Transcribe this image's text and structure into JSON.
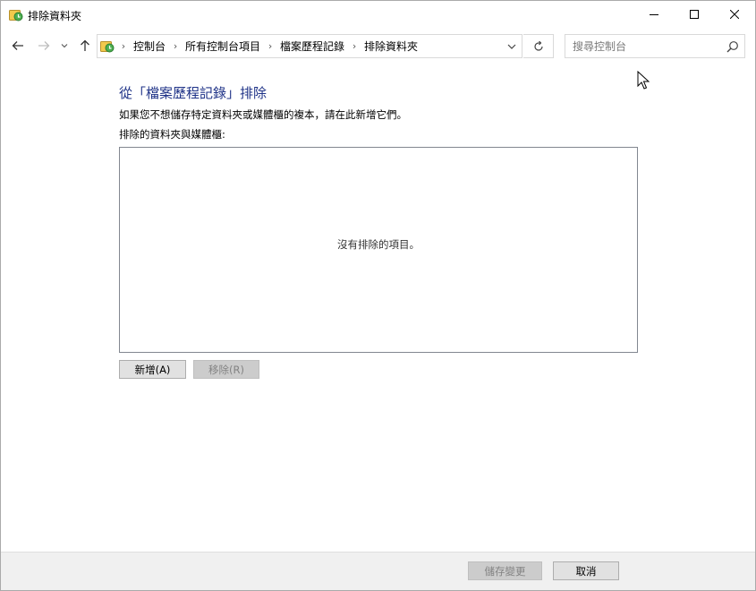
{
  "window": {
    "title": "排除資料夾"
  },
  "navbar": {
    "breadcrumbs": [
      "控制台",
      "所有控制台項目",
      "檔案歷程記錄",
      "排除資料夾"
    ],
    "search_placeholder": "搜尋控制台",
    "search_value": ""
  },
  "main": {
    "title": "從「檔案歷程記錄」排除",
    "description": "如果您不想儲存特定資料夾或媒體櫃的複本，請在此新增它們。",
    "list_label": "排除的資料夾與媒體櫃:",
    "empty_message": "沒有排除的項目。",
    "add_button": "新增(A)",
    "remove_button": "移除(R)"
  },
  "footer": {
    "save_button": "儲存變更",
    "cancel_button": "取消"
  },
  "colors": {
    "title_blue": "#1e3287",
    "footer_bg": "#f0f0f0",
    "disabled_button_bg": "#cccccc"
  },
  "icons": [
    "file-history-icon",
    "minimize-icon",
    "maximize-icon",
    "close-icon",
    "back-arrow-icon",
    "forward-arrow-icon",
    "recent-locations-chevron-icon",
    "up-arrow-icon",
    "address-dropdown-icon",
    "refresh-icon",
    "search-icon",
    "mouse-cursor-icon"
  ]
}
